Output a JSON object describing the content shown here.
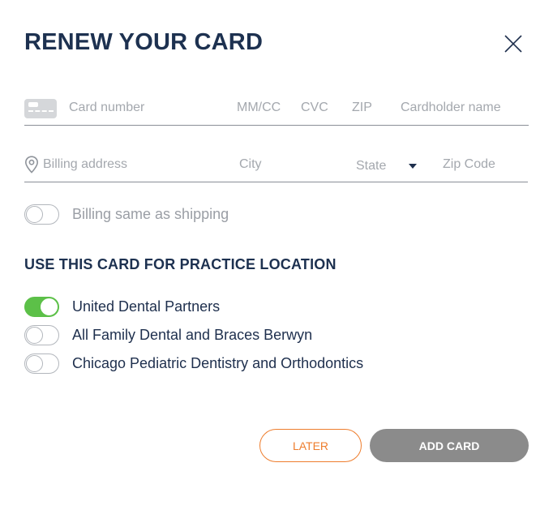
{
  "dialog": {
    "title": "RENEW YOUR CARD"
  },
  "card_row": {
    "card_number_placeholder": "Card number",
    "expiry_placeholder": "MM/CC",
    "cvc_placeholder": "CVC",
    "zip_placeholder": "ZIP",
    "cardholder_placeholder": "Cardholder name"
  },
  "address_row": {
    "billing_address_placeholder": "Billing address",
    "city_placeholder": "City",
    "state_placeholder": "State",
    "zip_code_placeholder": "Zip Code"
  },
  "billing_same": {
    "label": "Billing same as shipping",
    "checked": false
  },
  "locations": {
    "title": "USE THIS CARD FOR PRACTICE LOCATION",
    "items": [
      {
        "label": "United Dental Partners",
        "checked": true
      },
      {
        "label": "All Family Dental and Braces Berwyn",
        "checked": false
      },
      {
        "label": "Chicago Pediatric Dentistry and Orthodontics",
        "checked": false
      }
    ]
  },
  "actions": {
    "later_label": "LATER",
    "add_card_label": "ADD CARD"
  },
  "colors": {
    "title": "#1d3150",
    "toggle_on": "#5cc048",
    "later_accent": "#ee7d2d",
    "add_card_bg": "#8b8b8b"
  },
  "icons": [
    "close-icon",
    "credit-card-icon",
    "location-pin-icon",
    "caret-down-icon"
  ]
}
